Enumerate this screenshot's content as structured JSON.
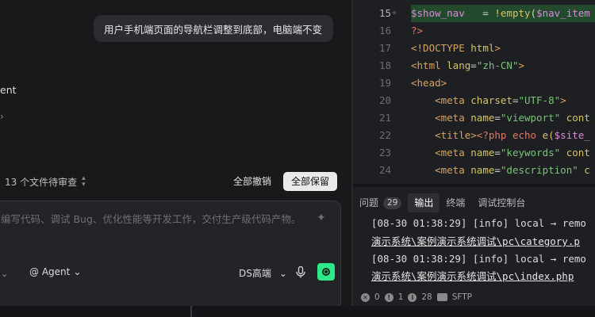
{
  "chat": {
    "user_message": "用户手机端页面的导航栏调整到底部，电脑端不变",
    "agent_fragment": "ent",
    "chevron_fragment": "›",
    "pending_text": "13 个文件待审查",
    "undo_all": "全部撤销",
    "keep_all": "全部保留",
    "composer_placeholder": "编写代码、调试 Bug、优化性能等开发工作，交付生产级代码产物。",
    "mode_chevron": "⌄",
    "agent_label": "@ Agent",
    "model_label": "DS高端",
    "chevron": "⌄"
  },
  "editor": {
    "lines": [
      {
        "num": "15",
        "marker": "+",
        "segments": [
          {
            "t": "$show_nav",
            "c": "var"
          },
          {
            "t": "   = ",
            "c": "op"
          },
          {
            "t": "!empty",
            "c": "fn"
          },
          {
            "t": "(",
            "c": "op"
          },
          {
            "t": "$nav_item",
            "c": "var"
          }
        ]
      },
      {
        "num": "16",
        "marker": "",
        "segments": [
          {
            "t": "?>",
            "c": "php"
          }
        ]
      },
      {
        "num": "17",
        "marker": "",
        "segments": [
          {
            "t": "<!DOCTYPE ",
            "c": "tag"
          },
          {
            "t": "html",
            "c": "attr"
          },
          {
            "t": ">",
            "c": "tag"
          }
        ]
      },
      {
        "num": "18",
        "marker": "",
        "segments": [
          {
            "t": "<html ",
            "c": "tag"
          },
          {
            "t": "lang",
            "c": "attr"
          },
          {
            "t": "=",
            "c": "op"
          },
          {
            "t": "\"zh-CN\"",
            "c": "str"
          },
          {
            "t": ">",
            "c": "tag"
          }
        ]
      },
      {
        "num": "19",
        "marker": "",
        "segments": [
          {
            "t": "<head>",
            "c": "tag"
          }
        ]
      },
      {
        "num": "20",
        "marker": "",
        "segments": [
          {
            "t": "    ",
            "c": "op"
          },
          {
            "t": "<meta ",
            "c": "tag"
          },
          {
            "t": "charset",
            "c": "attr"
          },
          {
            "t": "=",
            "c": "op"
          },
          {
            "t": "\"UTF-8\"",
            "c": "str"
          },
          {
            "t": ">",
            "c": "tag"
          }
        ]
      },
      {
        "num": "21",
        "marker": "",
        "segments": [
          {
            "t": "    ",
            "c": "op"
          },
          {
            "t": "<meta ",
            "c": "tag"
          },
          {
            "t": "name",
            "c": "attr"
          },
          {
            "t": "=",
            "c": "op"
          },
          {
            "t": "\"viewport\"",
            "c": "str"
          },
          {
            "t": " cont",
            "c": "attr"
          }
        ]
      },
      {
        "num": "22",
        "marker": "",
        "segments": [
          {
            "t": "    ",
            "c": "op"
          },
          {
            "t": "<title>",
            "c": "tag"
          },
          {
            "t": "<?php ",
            "c": "php"
          },
          {
            "t": "echo ",
            "c": "php"
          },
          {
            "t": "e(",
            "c": "fn"
          },
          {
            "t": "$site_",
            "c": "var"
          }
        ]
      },
      {
        "num": "23",
        "marker": "",
        "segments": [
          {
            "t": "    ",
            "c": "op"
          },
          {
            "t": "<meta ",
            "c": "tag"
          },
          {
            "t": "name",
            "c": "attr"
          },
          {
            "t": "=",
            "c": "op"
          },
          {
            "t": "\"keywords\"",
            "c": "str"
          },
          {
            "t": " cont",
            "c": "attr"
          }
        ]
      },
      {
        "num": "24",
        "marker": "",
        "segments": [
          {
            "t": "    ",
            "c": "op"
          },
          {
            "t": "<meta ",
            "c": "tag"
          },
          {
            "t": "name",
            "c": "attr"
          },
          {
            "t": "=",
            "c": "op"
          },
          {
            "t": "\"description\"",
            "c": "str"
          },
          {
            "t": " c",
            "c": "attr"
          }
        ]
      }
    ]
  },
  "panel": {
    "tabs": [
      {
        "label": "问题",
        "badge": "29",
        "active": false
      },
      {
        "label": "输出",
        "badge": "",
        "active": true
      },
      {
        "label": "终端",
        "badge": "",
        "active": false
      },
      {
        "label": "调试控制台",
        "badge": "",
        "active": false
      }
    ],
    "output": [
      {
        "text": "[08-30 01:38:29] [info] local → remo",
        "link": false
      },
      {
        "text": "演示系统\\案例演示系统调试\\pc\\category.p",
        "link": true
      },
      {
        "text": "[08-30 01:38:29] [info] local → remo",
        "link": false
      },
      {
        "text": "演示系统\\案例演示系统调试\\pc\\index.php",
        "link": true
      }
    ]
  },
  "status": {
    "errors": "0",
    "warnings": "1",
    "infos": "28",
    "sftp": "SFTP"
  },
  "colors": {
    "accent_green": "#2ee88a",
    "diff_added_bg": "#234a2d"
  }
}
